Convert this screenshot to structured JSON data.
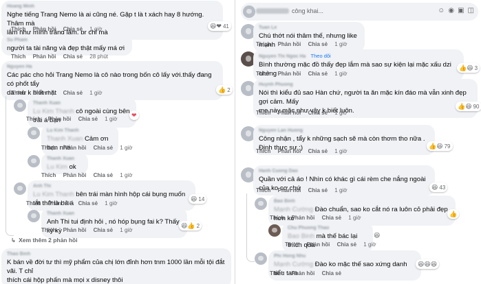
{
  "actions": {
    "like": "Thích",
    "reply": "Phản hồi",
    "share": "Chia sẻ"
  },
  "left": {
    "c1": {
      "text": "Nghe tiếng Trang Nemo là ai cũng né. Gặp t là t xách hay 8 hướng. Thâm mà\nlắm như mình trắng lắm, pr chỉ mà",
      "time": "1 giờ",
      "react_emoji": "😆❤",
      "react_count": "41"
    },
    "c2": {
      "text": "người ta tài năng và đẹp thật mấy má ơi",
      "time": "28 phút"
    },
    "c3": {
      "text": "Các pác cho hỏi Trang Nemo là cô nào trong bốn cô lấy với.thấy đang có phốt tẩy\nda mừ k biết mặt",
      "time": "1 giờ",
      "react_emoji": "👍",
      "react_count": "2"
    },
    "r1": {
      "text": "cô ngoài cùng bên trái á bạn",
      "time": "1 giờ",
      "react_emoji": "❤"
    },
    "r2": {
      "text": "Cảm ơn bạn nhé",
      "time": "1 giờ"
    },
    "r3": {
      "text": "ok",
      "time": "1 giờ"
    },
    "r4": {
      "text": "bên trái màn hình hộp cái bụng muốn tắt thở là bả á",
      "time": "1 giờ",
      "react_emoji": "😆",
      "react_count": "14"
    },
    "r5": {
      "text": "Anh Thi tui định hỏi , nó hóp bụng fai k? Thấy kỳ kỳ",
      "time": "1 giờ",
      "react_emoji": "😆👍",
      "react_count": "2"
    },
    "more": "Xem thêm 2 phản hồi",
    "c4": {
      "text": "K bán về đời tư thì mỹ phẩm của chị lớn đỉnh hơn tnm 1000 lần mỗi tội đắt vãi. T chỉ\nthích cái hộp phấn mà mọi x disney thôi"
    }
  },
  "right": {
    "topbar_text": "công khai...",
    "c1": {
      "text": "Chú thớt nói thâm thế, nhưng like mạnh",
      "time": "1 giờ"
    },
    "c2": {
      "badge": "Theo dõi",
      "text": "Bình thường mặc đồ thấy đẹp lắm mà sao sự kiện lại mặc xấu dzi chèng",
      "time": "1 giờ",
      "react_emoji": "👍😆",
      "react_count": "3"
    },
    "c3": {
      "text": "Nói thì kiểu đủ sao Hàn chứ, người ta ăn mặc kín đáo mà vẫn xinh đẹp gợi cảm. Mấy\nmẹ này mặc như vậy k biết luôn.",
      "time": "1 giờ",
      "react_emoji": "👍😆",
      "react_count": "90"
    },
    "c4": {
      "text": "Công nhận , tẩy k những sạch sẽ mà còn thơm tho nữa . Định thực sự :)",
      "time": "1 giờ",
      "react_emoji": "👍😆",
      "react_count": "79"
    },
    "c5": {
      "text": "Quần với cả áo ! Nhìn có khác gì cái rèm che nắng ngoài của ko cơ chứ",
      "time": "1 giờ",
      "react_emoji": "😆",
      "react_count": "43"
    },
    "r1": {
      "text": "Đào chuẩn, sao ko cắt nó ra luôn cỏ phải đẹp hơn ko",
      "time": "1 giờ",
      "react_emoji": "👍"
    },
    "r2": {
      "text": "mà thế bác lại thích quá",
      "time": "1 giờ",
      "react_emoji": "😆"
    },
    "r3": {
      "text": "Đào ko mặc thế sao xứng danh tiểu tam",
      "react_emoji": "😆😆😆"
    }
  }
}
